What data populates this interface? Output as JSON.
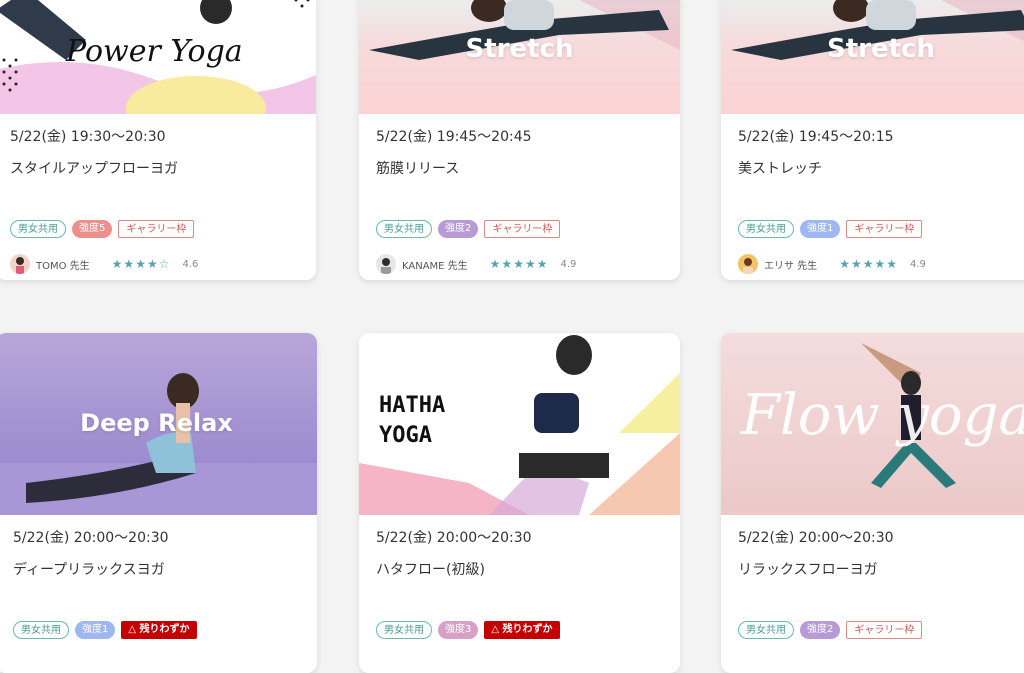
{
  "colors": {
    "strength_pink": "#f08e8e",
    "strength_purple": "#b79ad6",
    "strength_blue": "#9fb7f0",
    "warn_red": "#c40000",
    "star_teal": "#5aa3ad"
  },
  "cards": [
    {
      "hero_title": "Power Yoga",
      "time": "5/22(金) 19:30〜20:30",
      "name": "スタイルアップフローヨガ",
      "tags": {
        "gender": "男女共用",
        "strength": "強度5",
        "extra": "ギャラリー枠"
      },
      "instructor": "TOMO 先生",
      "stars": "★★★★☆",
      "rating": "4.6"
    },
    {
      "hero_title": "Stretch",
      "time": "5/22(金) 19:45〜20:45",
      "name": "筋膜リリース",
      "tags": {
        "gender": "男女共用",
        "strength": "強度2",
        "extra": "ギャラリー枠"
      },
      "instructor": "KANAME 先生",
      "stars": "★★★★★",
      "rating": "4.9"
    },
    {
      "hero_title": "Stretch",
      "time": "5/22(金) 19:45〜20:15",
      "name": "美ストレッチ",
      "tags": {
        "gender": "男女共用",
        "strength": "強度1",
        "extra": "ギャラリー枠"
      },
      "instructor": "エリサ 先生",
      "stars": "★★★★★",
      "rating": "4.9"
    },
    {
      "hero_title": "Deep Relax",
      "time": "5/22(金) 20:00〜20:30",
      "name": "ディープリラックスヨガ",
      "tags": {
        "gender": "男女共用",
        "strength": "強度1",
        "extra": "△ 残りわずか"
      }
    },
    {
      "hero_title_line1": "HATHA",
      "hero_title_line2": "YOGA",
      "time": "5/22(金) 20:00〜20:30",
      "name": "ハタフロー(初級)",
      "tags": {
        "gender": "男女共用",
        "strength": "強度3",
        "extra": "△ 残りわずか"
      }
    },
    {
      "hero_title": "Flow yoga",
      "time": "5/22(金) 20:00〜20:30",
      "name": "リラックスフローヨガ",
      "tags": {
        "gender": "男女共用",
        "strength": "強度2",
        "extra": "ギャラリー枠"
      }
    }
  ]
}
